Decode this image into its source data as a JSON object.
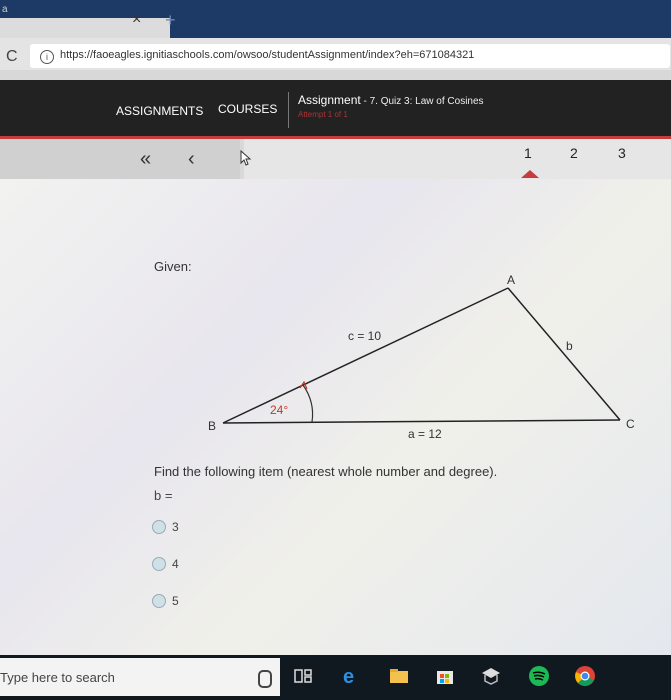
{
  "browser": {
    "tab_corner": "a",
    "tab_close": "×",
    "new_tab": "+",
    "reload_icon": "C",
    "url": "https://faoeagles.ignitiaschools.com/owsoo/studentAssignment/index?eh=671084321"
  },
  "header": {
    "nav_assignments": "ASSIGNMENTS",
    "nav_courses": "COURSES",
    "assignment_label": "Assignment",
    "assignment_title": " - 7. Quiz 3: Law of Cosines",
    "attempt": "Attempt 1 of 1"
  },
  "pager": {
    "first": "«",
    "prev": "‹",
    "pages": [
      "1",
      "2",
      "3"
    ]
  },
  "question": {
    "given": "Given:",
    "prompt": "Find the following item (nearest whole number and degree).",
    "variable": "b =",
    "options": [
      "3",
      "4",
      "5"
    ]
  },
  "diagram": {
    "vertex_a": "A",
    "vertex_b": "B",
    "vertex_c": "C",
    "side_c": "c = 10",
    "side_a": "a = 12",
    "side_b": "b",
    "angle": "24°",
    "angle_color": "#c0392b"
  },
  "taskbar": {
    "search_placeholder": "Type here to search",
    "icons": [
      "mic-icon",
      "task-view-icon",
      "edge-icon",
      "file-explorer-icon",
      "store-icon",
      "mail-icon",
      "spotify-icon",
      "chrome-icon"
    ]
  }
}
